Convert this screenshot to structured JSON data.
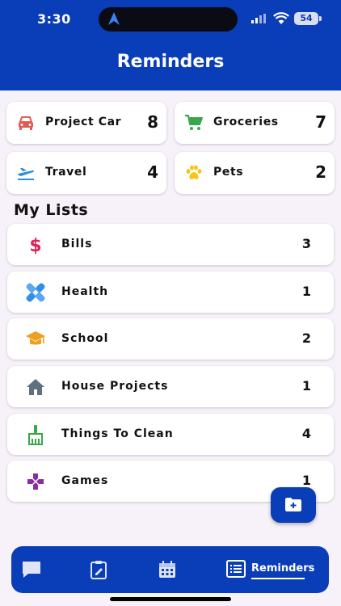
{
  "status_bar": {
    "time": "3:30",
    "battery": "54"
  },
  "header": {
    "title": "Reminders"
  },
  "summary": [
    {
      "label": "Project Car",
      "count": "8",
      "icon": "car-icon",
      "color": "#e05a52"
    },
    {
      "label": "Groceries",
      "count": "7",
      "icon": "cart-icon",
      "color": "#3aa84a"
    },
    {
      "label": "Travel",
      "count": "4",
      "icon": "airplane-icon",
      "color": "#2f8fd8"
    },
    {
      "label": "Pets",
      "count": "2",
      "icon": "paw-icon",
      "color": "#f5c518"
    }
  ],
  "my_lists": {
    "title": "My Lists",
    "items": [
      {
        "label": "Bills",
        "count": "3",
        "icon": "dollar-icon",
        "color": "#e0205a"
      },
      {
        "label": "Health",
        "count": "1",
        "icon": "bandage-icon",
        "color": "#2f8fe8"
      },
      {
        "label": "School",
        "count": "2",
        "icon": "graduation-cap-icon",
        "color": "#f0a020"
      },
      {
        "label": "House Projects",
        "count": "1",
        "icon": "house-icon",
        "color": "#5f7080"
      },
      {
        "label": "Things To Clean",
        "count": "4",
        "icon": "broom-icon",
        "color": "#3aa84a"
      },
      {
        "label": "Games",
        "count": "1",
        "icon": "gamepad-icon",
        "color": "#8a2aa8"
      }
    ]
  },
  "tabbar": {
    "tabs": [
      {
        "icon": "chat-icon"
      },
      {
        "icon": "clipboard-icon"
      },
      {
        "icon": "calendar-icon"
      },
      {
        "icon": "list-icon",
        "label": "Reminders",
        "active": true
      }
    ]
  },
  "fab": {
    "icon": "folder-plus-icon"
  },
  "colors": {
    "primary": "#0a3db8",
    "background": "#f7f1fa"
  }
}
